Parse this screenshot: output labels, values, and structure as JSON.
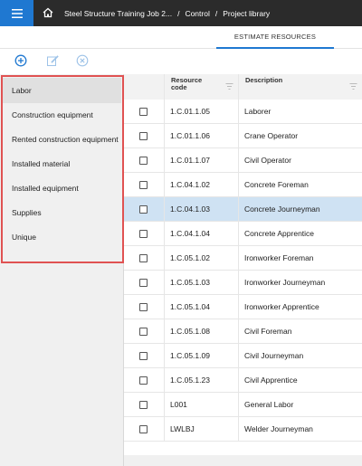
{
  "header": {
    "breadcrumb": [
      {
        "label": "Steel Structure Training Job 2..."
      },
      {
        "label": "Control"
      },
      {
        "label": "Project library"
      }
    ],
    "separator": "/"
  },
  "tabs": [
    {
      "label": "ESTIMATE RESOURCES"
    }
  ],
  "toolbar": {
    "icons": [
      "add-icon",
      "edit-icon",
      "delete-icon"
    ]
  },
  "categories": [
    {
      "label": "Labor",
      "selected": true
    },
    {
      "label": "Construction equipment"
    },
    {
      "label": "Rented construction equipment"
    },
    {
      "label": "Installed material"
    },
    {
      "label": "Installed equipment"
    },
    {
      "label": "Supplies"
    },
    {
      "label": "Unique"
    }
  ],
  "table": {
    "columns": [
      {
        "label": "Resource code"
      },
      {
        "label": "Description"
      }
    ],
    "rows": [
      {
        "code": "1.C.01.1.05",
        "description": "Laborer"
      },
      {
        "code": "1.C.01.1.06",
        "description": "Crane Operator"
      },
      {
        "code": "1.C.01.1.07",
        "description": "Civil Operator"
      },
      {
        "code": "1.C.04.1.02",
        "description": "Concrete Foreman"
      },
      {
        "code": "1.C.04.1.03",
        "description": "Concrete Journeyman",
        "highlight": true
      },
      {
        "code": "1.C.04.1.04",
        "description": "Concrete Apprentice"
      },
      {
        "code": "1.C.05.1.02",
        "description": "Ironworker Foreman"
      },
      {
        "code": "1.C.05.1.03",
        "description": "Ironworker Journeyman"
      },
      {
        "code": "1.C.05.1.04",
        "description": "Ironworker Apprentice"
      },
      {
        "code": "1.C.05.1.08",
        "description": "Civil Foreman"
      },
      {
        "code": "1.C.05.1.09",
        "description": "Civil Journeyman"
      },
      {
        "code": "1.C.05.1.23",
        "description": "Civil Apprentice"
      },
      {
        "code": "L001",
        "description": "General Labor"
      },
      {
        "code": "LWLBJ",
        "description": "Welder Journeyman"
      }
    ]
  },
  "colors": {
    "accent": "#1f78d1",
    "topbar": "#2b2b2b",
    "highlight_row": "#cfe2f3",
    "annotation_box": "#e05252"
  }
}
